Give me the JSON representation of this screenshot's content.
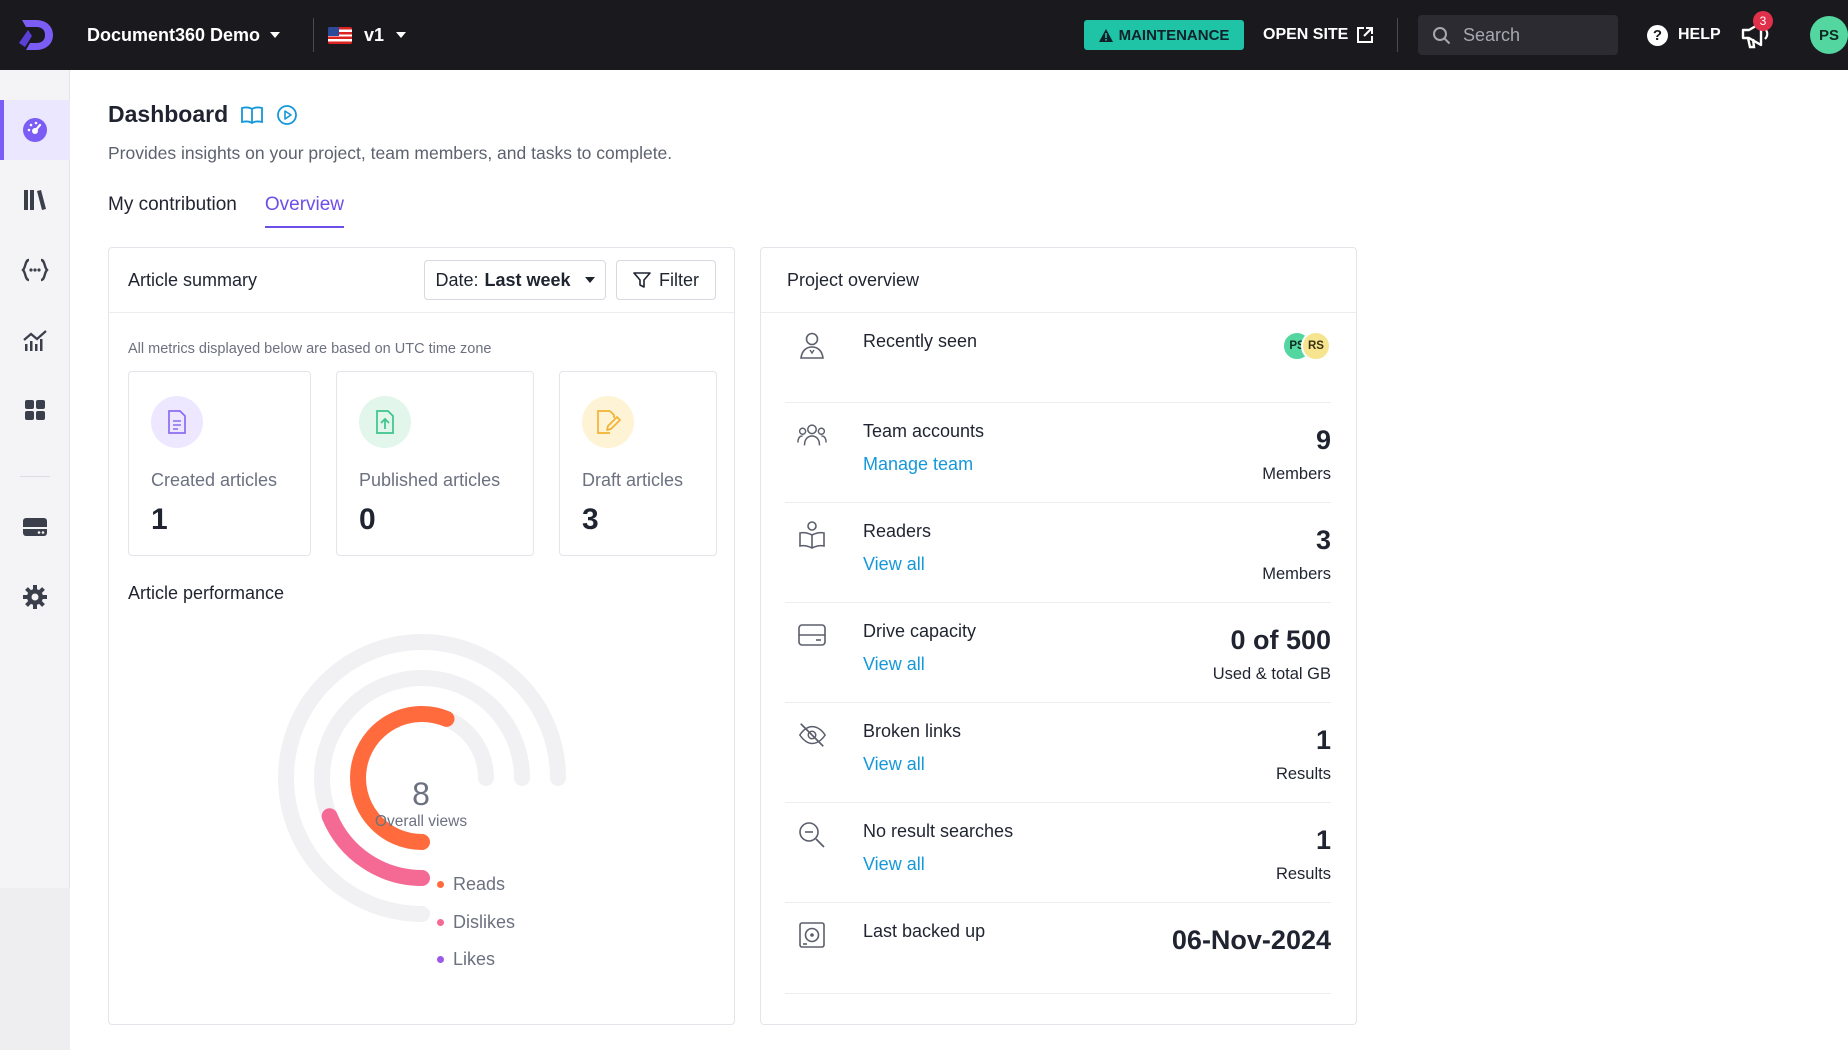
{
  "topbar": {
    "project_name": "Document360 Demo",
    "version": "v1",
    "maintenance_label": "MAINTENANCE",
    "open_site_label": "OPEN SITE",
    "search_placeholder": "Search",
    "help_label": "HELP",
    "notification_count": "3",
    "user_initials": "PS"
  },
  "sidebar": {
    "items": [
      {
        "icon": "dashboard-icon",
        "active": true
      },
      {
        "icon": "documentation-icon"
      },
      {
        "icon": "api-icon"
      },
      {
        "icon": "analytics-icon"
      },
      {
        "icon": "widgets-icon"
      },
      {
        "icon": "drive-icon"
      },
      {
        "icon": "settings-icon"
      }
    ]
  },
  "header": {
    "title": "Dashboard",
    "subtitle": "Provides insights on your project, team members, and tasks to complete."
  },
  "tabs": [
    {
      "label": "My contribution",
      "active": false
    },
    {
      "label": "Overview",
      "active": true
    }
  ],
  "article_summary": {
    "title": "Article summary",
    "date_prefix": "Date:",
    "date_value": "Last week",
    "filter_label": "Filter",
    "utc_note": "All metrics displayed below are based on UTC time zone",
    "stats": [
      {
        "label": "Created articles",
        "value": "1",
        "icon": "document-icon",
        "color": "#8b6cf0"
      },
      {
        "label": "Published articles",
        "value": "0",
        "icon": "upload-document-icon",
        "color": "#3cc48a"
      },
      {
        "label": "Draft articles",
        "value": "3",
        "icon": "edit-document-icon",
        "color": "#f2b233"
      }
    ]
  },
  "article_performance": {
    "title": "Article performance",
    "overall_value": "8",
    "overall_label": "Overall views",
    "legend": [
      {
        "label": "Reads",
        "color": "#ff6b3d"
      },
      {
        "label": "Dislikes",
        "color": "#f56a95"
      },
      {
        "label": "Likes",
        "color": "#9b59e6"
      }
    ],
    "chart_data": {
      "type": "pie",
      "categories": [
        "Reads",
        "Dislikes",
        "Likes"
      ],
      "values": [
        6,
        2,
        0
      ],
      "title": "",
      "total": 8
    }
  },
  "project_overview": {
    "title": "Project overview",
    "recently_seen": {
      "label": "Recently seen",
      "avatars": [
        {
          "initials": "PS",
          "color": "#54d6a0"
        },
        {
          "initials": "RS",
          "color": "#f6e48e"
        }
      ]
    },
    "rows": [
      {
        "label": "Team accounts",
        "link": "Manage team",
        "value": "9",
        "unit": "Members",
        "icon": "team-icon"
      },
      {
        "label": "Readers",
        "link": "View all",
        "value": "3",
        "unit": "Members",
        "icon": "reader-icon"
      },
      {
        "label": "Drive capacity",
        "link": "View all",
        "value": "0 of 500",
        "unit": "Used & total GB",
        "icon": "drive-icon"
      },
      {
        "label": "Broken links",
        "link": "View all",
        "value": "1",
        "unit": "Results",
        "icon": "broken-link-icon"
      },
      {
        "label": "No result searches",
        "link": "View all",
        "value": "1",
        "unit": "Results",
        "icon": "search-minus-icon"
      }
    ],
    "last_backup": {
      "label": "Last backed up",
      "value": "06-Nov-2024"
    }
  }
}
